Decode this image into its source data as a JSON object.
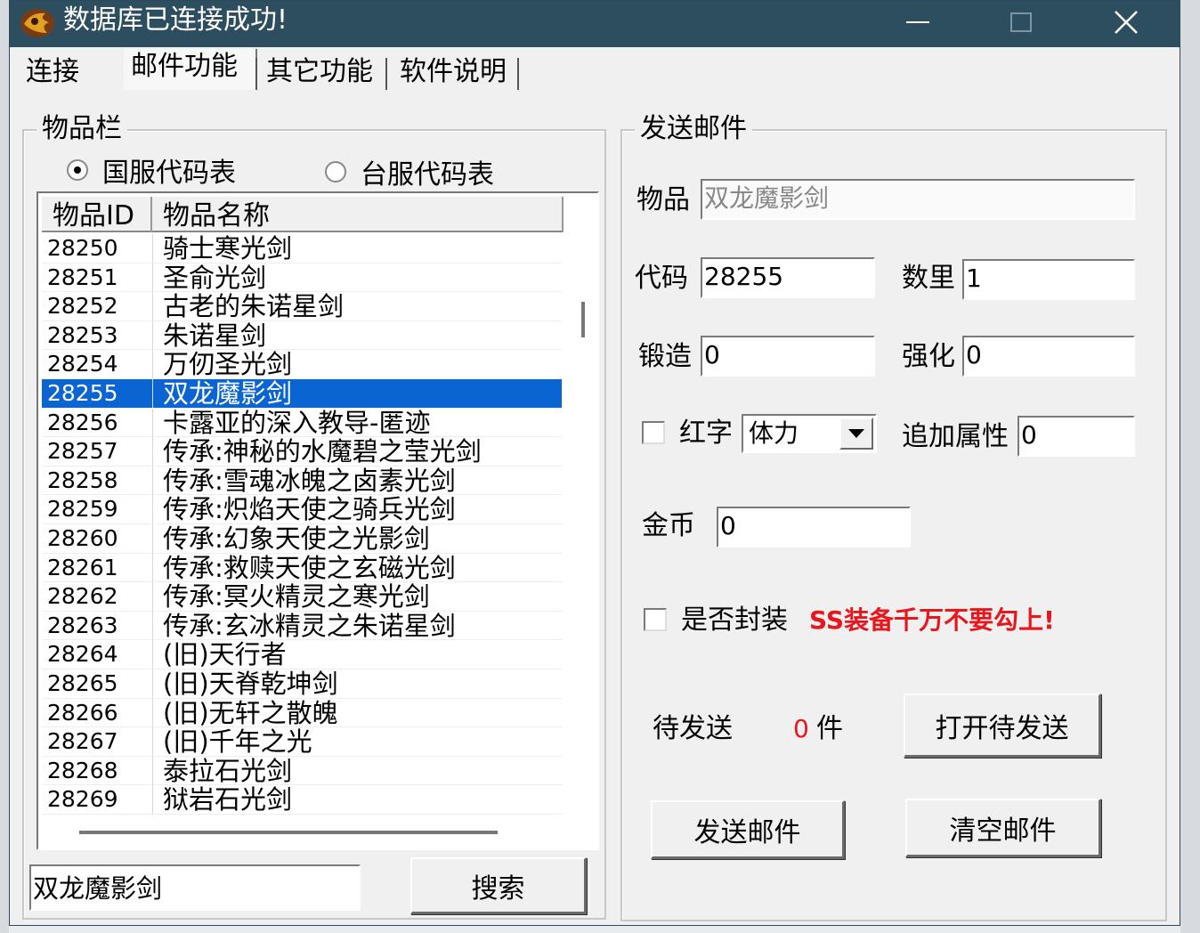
{
  "window": {
    "title": "数据库已连接成功!",
    "minimize_glyph": "—",
    "maximize_glyph": "☐",
    "close_glyph": "✕",
    "icon": "app-logo-icon"
  },
  "tabs": [
    {
      "label": "连接"
    },
    {
      "label": "邮件功能"
    },
    {
      "label": "其它功能"
    },
    {
      "label": "软件说明"
    }
  ],
  "items_panel": {
    "title": "物品栏",
    "radio_cn": "国服代码表",
    "radio_tw": "台服代码表",
    "col_id": "物品ID",
    "col_name": "物品名称",
    "rows": [
      {
        "id": "28250",
        "name": "骑士寒光剑"
      },
      {
        "id": "28251",
        "name": "圣俞光剑"
      },
      {
        "id": "28252",
        "name": "古老的朱诺星剑"
      },
      {
        "id": "28253",
        "name": "朱诺星剑"
      },
      {
        "id": "28254",
        "name": "万仞圣光剑"
      },
      {
        "id": "28255",
        "name": "双龙魔影剑"
      },
      {
        "id": "28256",
        "name": "卡露亚的深入教导-匿迹"
      },
      {
        "id": "28257",
        "name": "传承:神秘的水魔碧之莹光剑"
      },
      {
        "id": "28258",
        "name": "传承:雪魂冰魄之卤素光剑"
      },
      {
        "id": "28259",
        "name": "传承:炽焰天使之骑兵光剑"
      },
      {
        "id": "28260",
        "name": "传承:幻象天使之光影剑"
      },
      {
        "id": "28261",
        "name": "传承:救赎天使之玄磁光剑"
      },
      {
        "id": "28262",
        "name": "传承:冥火精灵之寒光剑"
      },
      {
        "id": "28263",
        "name": "传承:玄冰精灵之朱诺星剑"
      },
      {
        "id": "28264",
        "name": "(旧)天行者"
      },
      {
        "id": "28265",
        "name": "(旧)天脊乾坤剑"
      },
      {
        "id": "28266",
        "name": "(旧)无轩之散魄"
      },
      {
        "id": "28267",
        "name": "(旧)千年之光"
      },
      {
        "id": "28268",
        "name": "泰拉石光剑"
      },
      {
        "id": "28269",
        "name": "狱岩石光剑"
      }
    ],
    "selected_index": 5,
    "search_value": "双龙魔影剑",
    "search_button": "搜索"
  },
  "send_panel": {
    "title": "发送邮件",
    "item_label": "物品",
    "item_value": "双龙魔影剑",
    "code_label": "代码",
    "code_value": "28255",
    "qty_label": "数里",
    "qty_value": "1",
    "forge_label": "锻造",
    "forge_value": "0",
    "enhance_label": "强化",
    "enhance_value": "0",
    "red_label": "红字",
    "red_select": "体力",
    "extra_label": "追加属性",
    "extra_value": "0",
    "gold_label": "金币",
    "gold_value": "0",
    "seal_label": "是否封装",
    "seal_warning": "SS装备千万不要勾上!",
    "pending_label": "待发送",
    "pending_count": "0",
    "pending_unit": "件",
    "open_pending_button": "打开待发送",
    "send_button": "发送邮件",
    "clear_button": "清空邮件"
  },
  "colors": {
    "titlebar": "#2d4e5e",
    "selection": "#0a64d2",
    "warning": "#e8161d"
  }
}
